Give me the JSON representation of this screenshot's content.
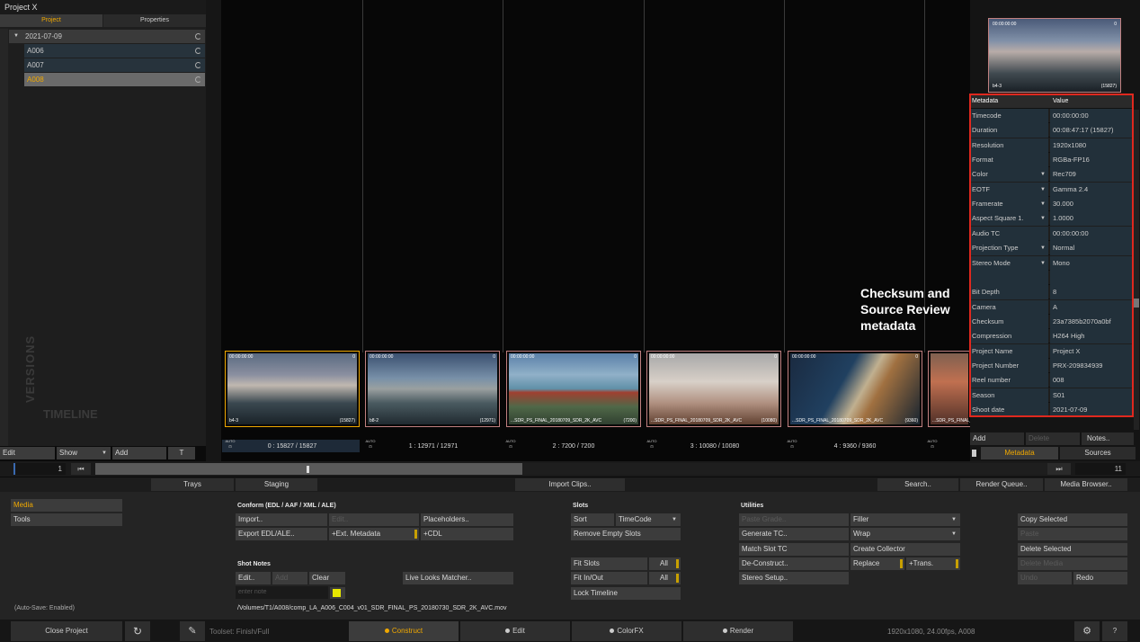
{
  "project": {
    "title": "Project X",
    "tabs": [
      "Project",
      "Properties"
    ],
    "date_group": "2021-07-09",
    "items": [
      "A006",
      "A007",
      "A008"
    ],
    "versions_label": "VERSIONS",
    "timeline_label": "TIMELINE",
    "bottom": {
      "edit": "Edit",
      "show": "Show",
      "add": "Add",
      "t": "T"
    }
  },
  "annotation": "Checksum and Source Review metadata",
  "preview": {
    "tc": "00:00:00:00",
    "bars": "0",
    "name": "b4-3",
    "count": "(15827)"
  },
  "thumbs": [
    {
      "tc": "00:00:00:00",
      "bars": "0",
      "name": "b4-3",
      "count": "(15827)",
      "slot": "0 : 15827 / 15827"
    },
    {
      "tc": "00:00:00:00",
      "bars": "0",
      "name": "b8-2",
      "count": "(12971)",
      "slot": "1 : 12971 / 12971"
    },
    {
      "tc": "00:00:00:00",
      "bars": "0",
      "name": "...SDR_PS_FINAL_20180709_SDR_2K_AVC",
      "count": "(7200)",
      "slot": "2 : 7200 / 7200"
    },
    {
      "tc": "00:00:00:00",
      "bars": "0",
      "name": "...SDR_PS_FINAL_20180709_SDR_2K_AVC",
      "count": "(10080)",
      "slot": "3 : 10080 / 10080"
    },
    {
      "tc": "00:00:00:00",
      "bars": "0",
      "name": "...SDR_PS_FINAL_20180709_SDR_2K_AVC",
      "count": "(9360)",
      "slot": "4 : 9360 / 9360"
    },
    {
      "tc": "",
      "bars": "",
      "name": "...SDR_PS_FINAL_",
      "count": "",
      "slot": ""
    }
  ],
  "auto_label": "AUTO",
  "metadata": {
    "header": {
      "key": "Metadata",
      "value": "Value"
    },
    "rows": [
      {
        "k": "Timecode",
        "v": "00:00:00:00",
        "dd": ""
      },
      {
        "k": "Duration",
        "v": "00:08:47:17 (15827)",
        "dd": ""
      },
      {
        "k": "Resolution",
        "v": "1920x1080",
        "dd": ""
      },
      {
        "k": "Format",
        "v": "RGBa-FP16",
        "dd": ""
      },
      {
        "k": "Color",
        "v": "Rec709",
        "dd": "▼"
      },
      {
        "k": "EOTF",
        "v": "Gamma 2.4",
        "dd": "▼"
      },
      {
        "k": "Framerate",
        "v": "30.000",
        "dd": "▼"
      },
      {
        "k": "Aspect Square 1.",
        "v": "1.0000",
        "dd": "▼"
      },
      {
        "k": "Audio TC",
        "v": "00:00:00:00",
        "dd": ""
      },
      {
        "k": "Projection Type",
        "v": "Normal",
        "dd": "▼"
      },
      {
        "k": "Stereo Mode",
        "v": "Mono",
        "dd": "▼"
      },
      {
        "k": "",
        "v": "",
        "dd": ""
      },
      {
        "k": "Bit Depth",
        "v": "8",
        "dd": ""
      },
      {
        "k": "Camera",
        "v": "A",
        "dd": ""
      },
      {
        "k": "Checksum",
        "v": "23a7385b2070a0bf",
        "dd": ""
      },
      {
        "k": "Compression",
        "v": "H264 High",
        "dd": ""
      },
      {
        "k": "Project Name",
        "v": "Project X",
        "dd": ""
      },
      {
        "k": "Project Number",
        "v": "PRX-209834939",
        "dd": ""
      },
      {
        "k": "Reel number",
        "v": "008",
        "dd": ""
      },
      {
        "k": "Season",
        "v": "S01",
        "dd": ""
      },
      {
        "k": "Shoot date",
        "v": "2021-07-09",
        "dd": ""
      }
    ],
    "buttons": {
      "add": "Add",
      "delete": "Delete",
      "notes": "Notes.."
    },
    "tabs": [
      "Metadata",
      "Sources"
    ]
  },
  "timeline": {
    "start": "1",
    "end": "11"
  },
  "toolbar": {
    "trays": "Trays",
    "staging": "Staging",
    "import_clips": "Import Clips..",
    "search": "Search..",
    "render_queue": "Render Queue..",
    "media_browser": "Media Browser.."
  },
  "left_menu": [
    "Media",
    "Tools"
  ],
  "conform": {
    "title": "Conform (EDL / AAF / XML / ALE)",
    "import": "Import..",
    "edit": "Edit..",
    "placeholders": "Placeholders..",
    "export": "Export EDL/ALE..",
    "ext_meta": "+Ext. Metadata",
    "cdl": "+CDL"
  },
  "shot_notes": {
    "title": "Shot Notes",
    "edit": "Edit..",
    "add": "Add",
    "clear": "Clear",
    "placeholder": "enter note",
    "live_looks": "Live Looks Matcher.."
  },
  "slots": {
    "title": "Slots",
    "sort": "Sort",
    "sort_value": "TimeCode",
    "remove_empty": "Remove Empty Slots",
    "fit_slots": "Fit Slots",
    "fit_inout": "Fit In/Out",
    "all": "All",
    "lock": "Lock Timeline"
  },
  "utilities": {
    "title": "Utilities",
    "paste_grade": "Paste Grade..",
    "generate_tc": "Generate TC..",
    "match_slot": "Match Slot TC",
    "deconstruct": "De-Construct..",
    "stereo": "Stereo Setup..",
    "filler": "Filler",
    "wrap": "Wrap",
    "create_collector": "Create Collector",
    "replace": "Replace",
    "trans": "+Trans."
  },
  "clipboard": {
    "copy": "Copy Selected",
    "paste": "Paste",
    "delete": "Delete Selected",
    "delete_media": "Delete Media",
    "undo": "Undo",
    "redo": "Redo"
  },
  "autosave": "(Auto-Save: Enabled)",
  "filepath": "/Volumes/T1/A008/comp_LA_A006_C004_v01_SDR_FINAL_PS_20180730_SDR_2K_AVC.mov",
  "status": {
    "close_project": "Close Project",
    "toolset": "Toolset: Finish/Full",
    "tabs": [
      "Construct",
      "Edit",
      "ColorFX",
      "Render"
    ],
    "info": "1920x1080, 24.00fps, A008",
    "help": "?"
  },
  "colors": {
    "accent": "#f0a800",
    "highlight_box": "#e0281e"
  }
}
